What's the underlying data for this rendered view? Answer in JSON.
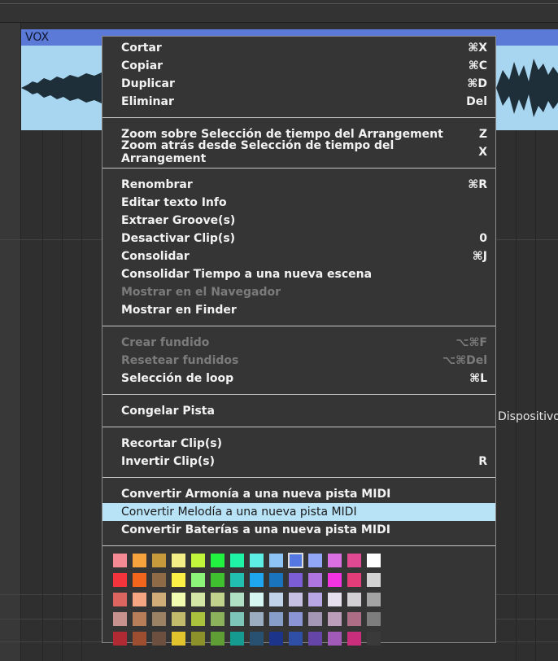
{
  "track": {
    "clip_name": "VOX",
    "side_label": "Dispositivo"
  },
  "menu": {
    "groups": [
      [
        {
          "label": "Cortar",
          "shortcut": "⌘X"
        },
        {
          "label": "Copiar",
          "shortcut": "⌘C"
        },
        {
          "label": "Duplicar",
          "shortcut": "⌘D"
        },
        {
          "label": "Eliminar",
          "shortcut": "Del"
        }
      ],
      [
        {
          "label": "Zoom sobre Selección de tiempo del Arrangement",
          "shortcut": "Z"
        },
        {
          "label": "Zoom atrás desde Selección de tiempo del Arrangement",
          "shortcut": "X"
        }
      ],
      [
        {
          "label": "Renombrar",
          "shortcut": "⌘R"
        },
        {
          "label": "Editar texto Info",
          "shortcut": ""
        },
        {
          "label": "Extraer Groove(s)",
          "shortcut": ""
        },
        {
          "label": "Desactivar Clip(s)",
          "shortcut": "0"
        },
        {
          "label": "Consolidar",
          "shortcut": "⌘J"
        },
        {
          "label": "Consolidar Tiempo a una nueva escena",
          "shortcut": ""
        },
        {
          "label": "Mostrar en el Navegador",
          "shortcut": "",
          "disabled": true
        },
        {
          "label": "Mostrar en Finder",
          "shortcut": ""
        }
      ],
      [
        {
          "label": "Crear fundido",
          "shortcut": "⌥⌘F",
          "disabled": true
        },
        {
          "label": "Resetear fundidos",
          "shortcut": "⌥⌘Del",
          "disabled": true
        },
        {
          "label": "Selección de loop",
          "shortcut": "⌘L"
        }
      ],
      [
        {
          "label": "Congelar Pista",
          "shortcut": ""
        }
      ],
      [
        {
          "label": "Recortar Clip(s)",
          "shortcut": ""
        },
        {
          "label": "Invertir Clip(s)",
          "shortcut": "R"
        }
      ],
      [
        {
          "label": "Convertir Armonía a una nueva pista MIDI",
          "shortcut": ""
        },
        {
          "label": "Convertir Melodía a una nueva pista MIDI",
          "shortcut": "",
          "highlighted": true
        },
        {
          "label": "Convertir Baterías a una nueva pista MIDI",
          "shortcut": ""
        }
      ]
    ]
  },
  "palette": {
    "selected": [
      0,
      9
    ],
    "rows": [
      [
        "#f58a94",
        "#f6a33e",
        "#c69a3a",
        "#f3ee85",
        "#c0f53b",
        "#22f340",
        "#1ff3a5",
        "#5deee4",
        "#8ec4f5",
        "#5477e1",
        "#92a7f5",
        "#d96fe1",
        "#e14a93",
        "#ffffff"
      ],
      [
        "#f3343c",
        "#f2651c",
        "#8e6a47",
        "#fbf045",
        "#8cf579",
        "#3ec02f",
        "#22bfb1",
        "#1ea7ee",
        "#1a74bd",
        "#7c5dd3",
        "#ae75e0",
        "#f233e2",
        "#e23c79",
        "#d2d2d2"
      ],
      [
        "#dc6560",
        "#f6a583",
        "#d0ac78",
        "#f1fcb0",
        "#d4e6a5",
        "#c0d28b",
        "#b0e1c4",
        "#d6f7f1",
        "#bfd2e7",
        "#c6c0e3",
        "#b7a5e4",
        "#e5dfed",
        "#d3d0d3",
        "#a4a4a4"
      ],
      [
        "#c7928d",
        "#b87e5a",
        "#9b8265",
        "#c3bb6c",
        "#a9c13c",
        "#8cb25c",
        "#7ec5b9",
        "#9baec1",
        "#879ec9",
        "#8b94d5",
        "#a497b6",
        "#bb9fba",
        "#ad6d84",
        "#7d7d7d"
      ],
      [
        "#b02a33",
        "#9e4e30",
        "#6c4f3f",
        "#e1c42d",
        "#8c912a",
        "#5f9e34",
        "#159b8f",
        "#285070",
        "#1c3489",
        "#2f4fa6",
        "#6645a8",
        "#a15ab7",
        "#c82e7b",
        "#3a3a3a"
      ]
    ]
  }
}
